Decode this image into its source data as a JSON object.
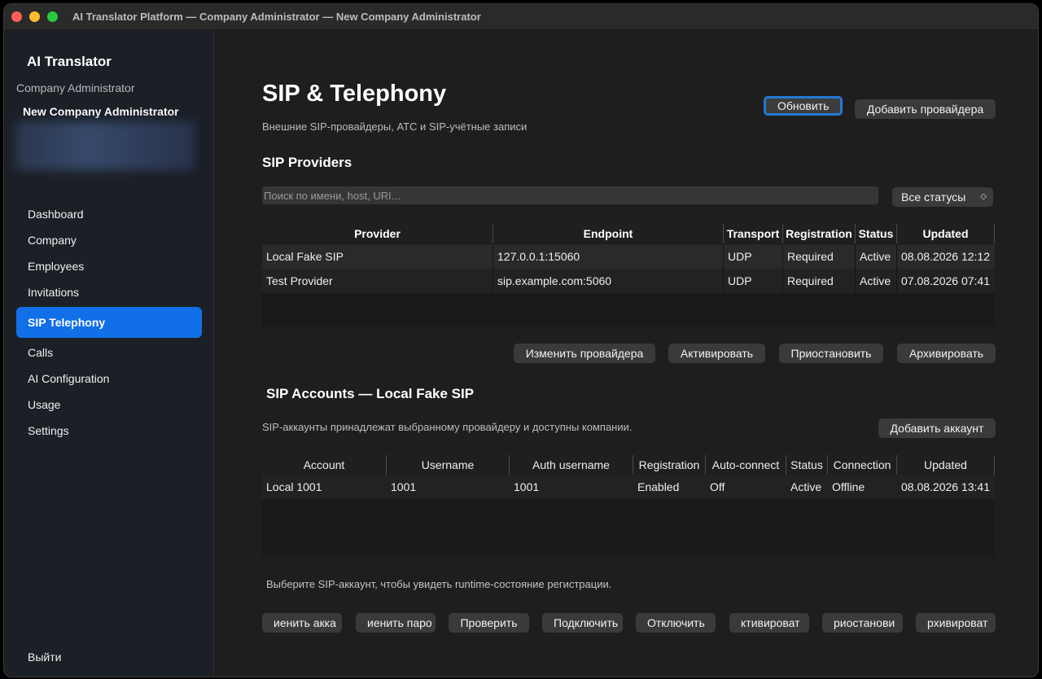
{
  "window": {
    "title": "AI Translator Platform — Company Administrator — New Company Administrator"
  },
  "sidebar": {
    "brand": "AI Translator",
    "role": "Company Administrator",
    "user_name": "New Company Administrator",
    "items": [
      {
        "label": "Dashboard"
      },
      {
        "label": "Company"
      },
      {
        "label": "Employees"
      },
      {
        "label": "Invitations"
      },
      {
        "label": "SIP  Telephony"
      },
      {
        "label": "Calls"
      },
      {
        "label": "AI Configuration"
      },
      {
        "label": "Usage"
      },
      {
        "label": "Settings"
      }
    ],
    "logout": "Выйти"
  },
  "header": {
    "title": "SIP & Telephony",
    "subtitle": "Внешние SIP-провайдеры, АТС и SIP-учётные записи",
    "refresh_label": "Обновить",
    "add_provider_label": "Добавить провайдера"
  },
  "providers": {
    "title": "SIP Providers",
    "search_placeholder": "Поиск по имени, host, URI...",
    "status_filter": "Все статусы",
    "columns": [
      "Provider",
      "Endpoint",
      "Transport",
      "Registration",
      "Status",
      "Updated"
    ],
    "rows": [
      [
        "Local Fake SIP",
        "127.0.0.1:15060",
        "UDP",
        "Required",
        "Active",
        "08.08.2026 12:12"
      ],
      [
        "Test Provider",
        "sip.example.com:5060",
        "UDP",
        "Required",
        "Active",
        "07.08.2026 07:41"
      ]
    ],
    "actions": {
      "edit": "Изменить провайдера",
      "activate": "Активировать",
      "suspend": "Приостановить",
      "archive": "Архивировать"
    }
  },
  "accounts": {
    "title": "SIP Accounts — Local Fake SIP",
    "subtitle": "SIP-аккаунты принадлежат выбранному провайдеру и доступны компании.",
    "add_label": "Добавить аккаунт",
    "columns": [
      "Account",
      "Username",
      "Auth username",
      "Registration",
      "Auto-connect",
      "Status",
      "Connection",
      "Updated"
    ],
    "rows": [
      [
        "Local 1001",
        "1001",
        "1001",
        "Enabled",
        "Off",
        "Active",
        "Offline",
        "08.08.2026 13:41"
      ]
    ],
    "hint": "Выберите SIP-аккаунт, чтобы увидеть runtime-состояние регистрации.",
    "actions": {
      "edit": "иенить акка",
      "change_password": "иенить паро",
      "check": "Проверить",
      "connect": "Подключить",
      "disconnect": "Отключить",
      "activate": "ктивироват",
      "suspend": "риостанови",
      "archive": "рхивироват"
    }
  }
}
